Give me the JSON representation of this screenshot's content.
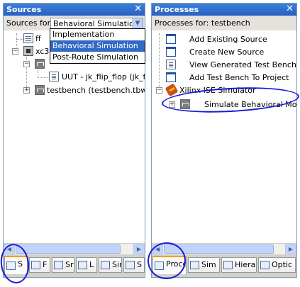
{
  "sources": {
    "title": "Sources",
    "for_label": "Sources for:",
    "selected": "Behavioral Simulation",
    "dropdown_options": [
      "Implementation",
      "Behavioral Simulation",
      "Post-Route Simulation"
    ],
    "tree": [
      "ff",
      "xc3s",
      "UUT - jk_flip_flop (jk_flip_",
      "testbench (testbench.tbw)"
    ],
    "tabs": [
      "S",
      "F",
      "Sr",
      "L",
      "Sim",
      "S"
    ]
  },
  "processes": {
    "title": "Processes",
    "for_label": "Processes for: testbench",
    "items": [
      "Add Existing Source",
      "Create New Source",
      "View Generated Test Bench A",
      "Add Test Bench To Project",
      "Xilinx ISE Simulator",
      "Simulate Behavioral Mode"
    ],
    "tabs": [
      "Proce",
      "Sim (",
      "Hierar",
      "Optic"
    ]
  },
  "colors": {
    "title_bar": "#2760c4",
    "annotation_circle": "#1a1ad8",
    "selection": "#316ac5"
  }
}
